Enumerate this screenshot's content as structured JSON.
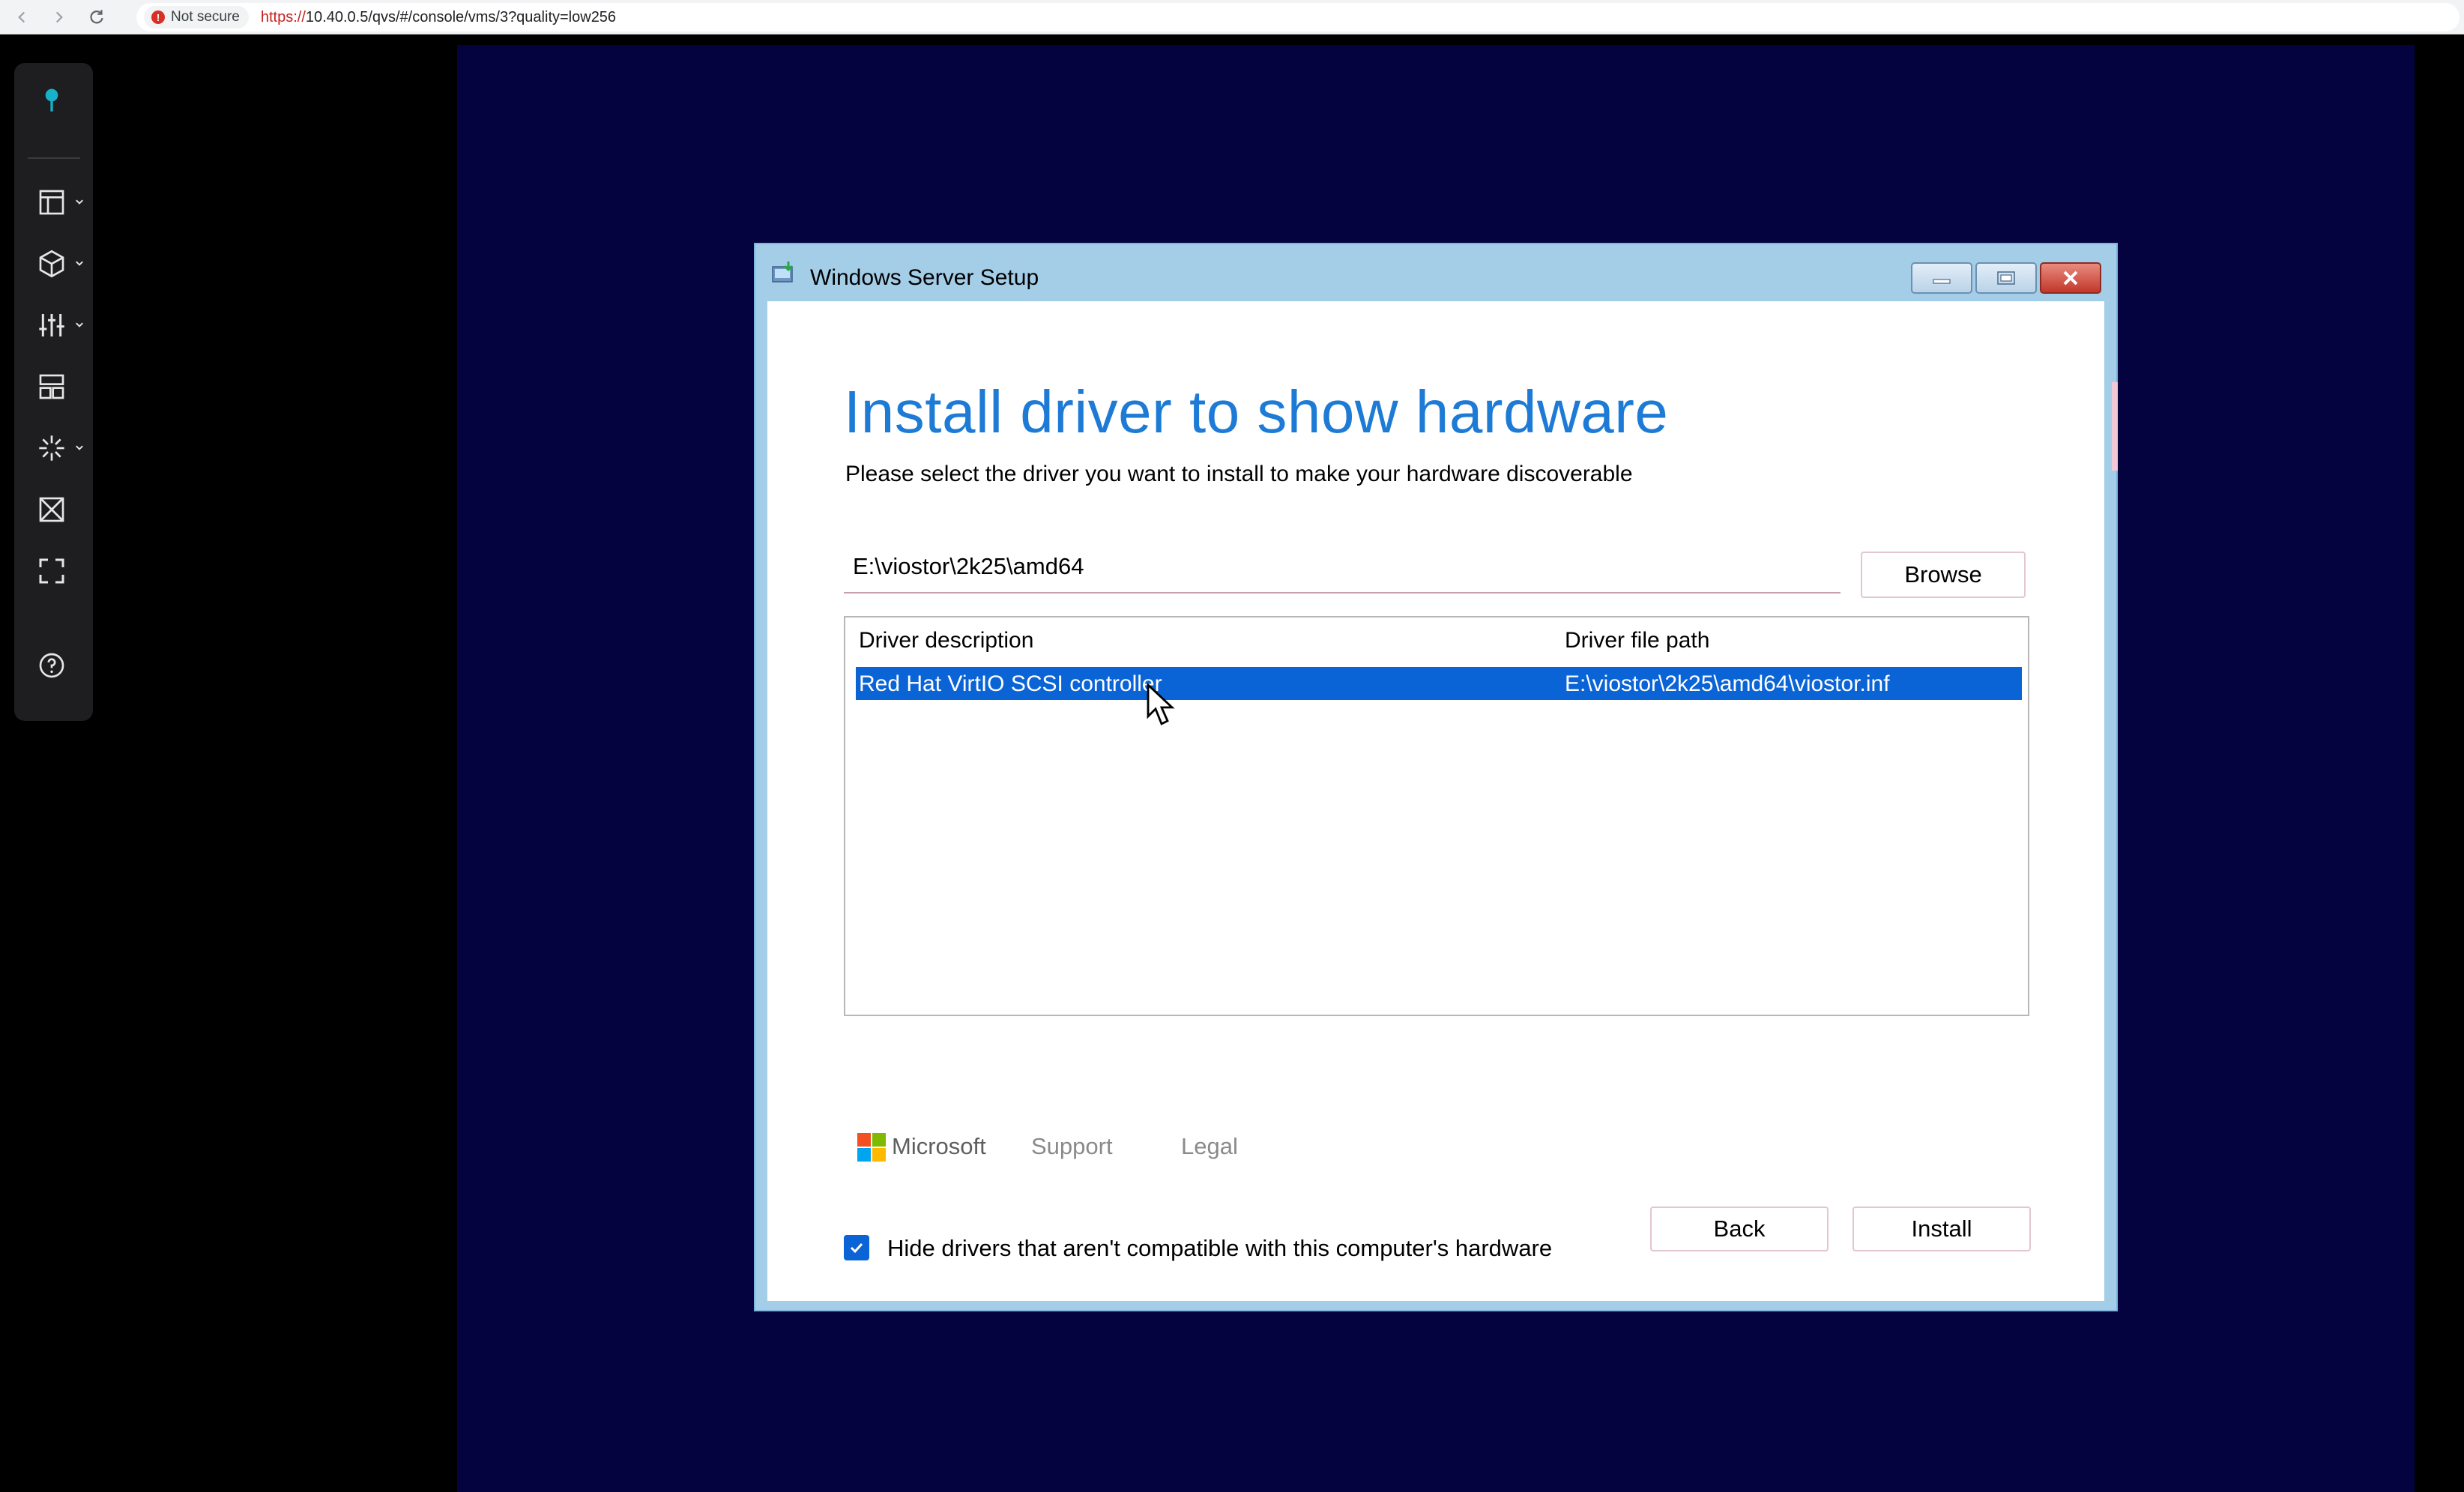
{
  "browser": {
    "security_label": "Not secure",
    "url_scheme": "https://",
    "url_rest": "10.40.0.5/qvs/#/console/vms/3?quality=low256"
  },
  "sidebar": {
    "items": [
      {
        "icon": "location-pin-icon"
      },
      {
        "icon": "dashboard-layout-icon"
      },
      {
        "icon": "cube-icon"
      },
      {
        "icon": "sliders-icon"
      },
      {
        "icon": "grid-layout-icon"
      },
      {
        "icon": "starburst-icon"
      },
      {
        "icon": "expand-arrows-icon"
      },
      {
        "icon": "fullscreen-icon"
      },
      {
        "icon": "help-icon"
      }
    ]
  },
  "setup": {
    "window_title": "Windows Server Setup",
    "heading": "Install driver to show hardware",
    "subheading": "Please select the driver you want to install to make your hardware discoverable",
    "path_value": "E:\\viostor\\2k25\\amd64",
    "browse_label": "Browse",
    "columns": {
      "description": "Driver description",
      "path": "Driver file path"
    },
    "rows": [
      {
        "description": "Red Hat VirtIO SCSI controller",
        "path": "E:\\viostor\\2k25\\amd64\\viostor.inf",
        "selected": true
      }
    ],
    "hide_incompatible_label": "Hide drivers that aren't compatible with this computer's hardware",
    "hide_incompatible_checked": true,
    "brand": "Microsoft",
    "support_label": "Support",
    "legal_label": "Legal",
    "back_label": "Back",
    "install_label": "Install"
  },
  "colors": {
    "accent": "#1d7bd6",
    "selection": "#0a64d6",
    "vm_background": "#04033f",
    "sidebar_icon": "#e6e6e6",
    "sidebar_active": "#17b2c9"
  }
}
